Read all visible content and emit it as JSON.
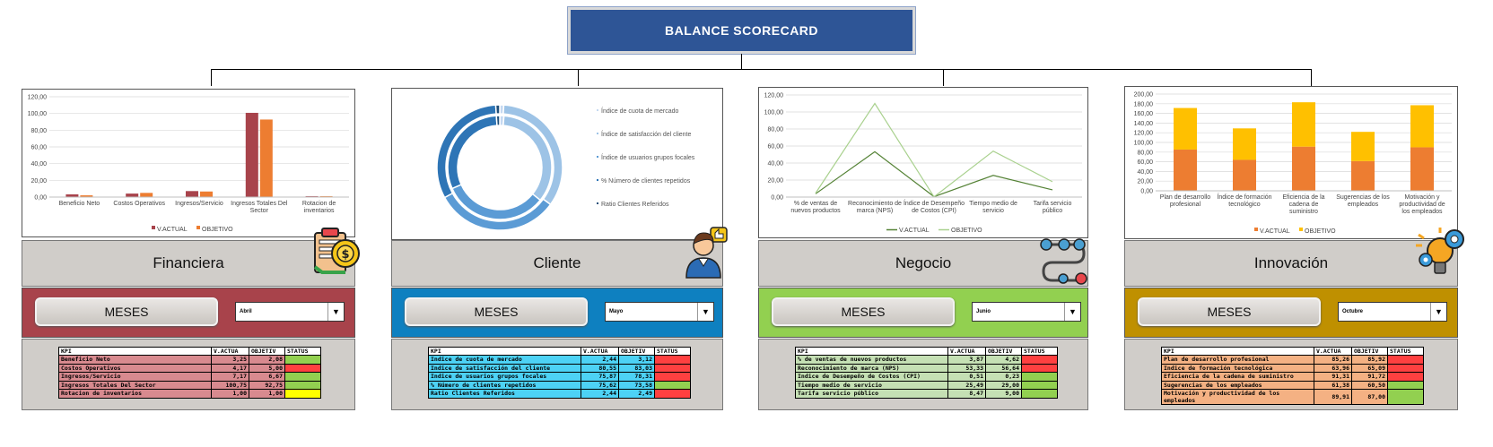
{
  "title": "BALANCE SCORECARD",
  "panels": [
    {
      "name": "Financiera",
      "meses_label": "MESES",
      "month": "Abril",
      "chart_color_band": "#a8434b",
      "table_row_color": "#d88a8f",
      "kpi_headers": [
        "KPI",
        "V.ACTUA",
        "OBJETIV",
        "STATUS"
      ],
      "rows": [
        {
          "kpi": "Beneficio Neto",
          "actual": "3,25",
          "objetivo": "2,08",
          "status": "#92d050"
        },
        {
          "kpi": "Costos Operativos",
          "actual": "4,17",
          "objetivo": "5,00",
          "status": "#ff4040"
        },
        {
          "kpi": "Ingresos/Servicio",
          "actual": "7,17",
          "objetivo": "6,67",
          "status": "#92d050"
        },
        {
          "kpi": "Ingresos Totales Del Sector",
          "actual": "100,75",
          "objetivo": "92,75",
          "status": "#92d050"
        },
        {
          "kpi": "Rotacion de inventarios",
          "actual": "1,00",
          "objetivo": "1,00",
          "status": "#ffff00"
        }
      ]
    },
    {
      "name": "Cliente",
      "meses_label": "MESES",
      "month": "Mayo",
      "chart_color_band": "#0e80c0",
      "table_row_color": "#4dd2f5",
      "kpi_headers": [
        "KPI",
        "V.ACTUA",
        "OBJETIV",
        "STATUS"
      ],
      "rows": [
        {
          "kpi": "Indice de cuota de mercado",
          "actual": "2,44",
          "objetivo": "3,12",
          "status": "#ff4040"
        },
        {
          "kpi": "Indice de satisfacción del cliente",
          "actual": "80,55",
          "objetivo": "83,03",
          "status": "#ff4040"
        },
        {
          "kpi": "Indice de usuarios grupos focales",
          "actual": "75,87",
          "objetivo": "78,31",
          "status": "#ff4040"
        },
        {
          "kpi": "% Número de clientes repetidos",
          "actual": "75,62",
          "objetivo": "73,58",
          "status": "#92d050"
        },
        {
          "kpi": "Ratio Clientes Referidos",
          "actual": "2,44",
          "objetivo": "2,49",
          "status": "#ff4040"
        }
      ]
    },
    {
      "name": "Negocio",
      "meses_label": "MESES",
      "month": "Junio",
      "chart_color_band": "#92d050",
      "table_row_color": "#c5e0b4",
      "kpi_headers": [
        "KPI",
        "V.ACTUA",
        "OBJETIV",
        "STATUS"
      ],
      "rows": [
        {
          "kpi": "% de ventas de nuevos productos",
          "actual": "3,87",
          "objetivo": "4,62",
          "status": "#ff4040"
        },
        {
          "kpi": "Reconocimiento de marca (NPS)",
          "actual": "53,33",
          "objetivo": "56,64",
          "status": "#ff4040"
        },
        {
          "kpi": "Indice de Desempeño de Costos (CPI)",
          "actual": "0,51",
          "objetivo": "0,23",
          "status": "#92d050"
        },
        {
          "kpi": "Tiempo medio de servicio",
          "actual": "25,49",
          "objetivo": "29,00",
          "status": "#92d050"
        },
        {
          "kpi": "Tarifa servicio público",
          "actual": "8,47",
          "objetivo": "9,00",
          "status": "#92d050"
        }
      ]
    },
    {
      "name": "Innovación",
      "meses_label": "MESES",
      "month": "Octubre",
      "chart_color_band": "#bf9000",
      "table_row_color": "#f4b183",
      "kpi_headers": [
        "KPI",
        "V.ACTUA",
        "OBJETIV",
        "STATUS"
      ],
      "rows": [
        {
          "kpi": "Plan de desarrollo profesional",
          "actual": "85,26",
          "objetivo": "85,92",
          "status": "#ff4040"
        },
        {
          "kpi": "Indice de formación tecnológica",
          "actual": "63,96",
          "objetivo": "65,09",
          "status": "#ff4040"
        },
        {
          "kpi": "Eficiencia de la cadena de suministro",
          "actual": "91,31",
          "objetivo": "91,72",
          "status": "#ff4040"
        },
        {
          "kpi": "Sugerencias de los empleados",
          "actual": "61,38",
          "objetivo": "60,50",
          "status": "#92d050"
        },
        {
          "kpi": "Motivación y productividad de los empleados",
          "actual": "89,91",
          "objetivo": "87,00",
          "status": "#92d050"
        }
      ]
    }
  ],
  "chart_data": [
    {
      "type": "bar",
      "categories": [
        "Beneficio Neto",
        "Costos Operativos",
        "Ingresos/Servicio",
        "Ingresos Totales Del Sector",
        "Rotacion de inventarios"
      ],
      "series": [
        {
          "name": "V.ACTUAL",
          "values": [
            3.25,
            4.17,
            7.17,
            100.75,
            1.0
          ],
          "color": "#a8434b"
        },
        {
          "name": "OBJETIVO",
          "values": [
            2.08,
            5.0,
            6.67,
            92.75,
            1.0
          ],
          "color": "#ed7d31"
        }
      ],
      "yticks": [
        "0,00",
        "20,00",
        "40,00",
        "60,00",
        "80,00",
        "100,00",
        "120,00"
      ],
      "ylim": [
        0,
        120
      ]
    },
    {
      "type": "pie",
      "categories": [
        "Índice de cuota de mercado",
        "Índice de satisfacción del cliente",
        "Índice de usuarios grupos focales",
        "% Número de clientes repetidos",
        "Ratio Clientes Referidos"
      ],
      "series": [
        {
          "name": "outer",
          "values": [
            2.44,
            80.55,
            75.87,
            75.62,
            2.44
          ]
        },
        {
          "name": "inner",
          "values": [
            3.12,
            83.03,
            78.31,
            73.58,
            2.49
          ]
        }
      ],
      "colors": [
        "#c5d9f1",
        "#9dc3e6",
        "#5b9bd5",
        "#2e75b6",
        "#1f4e79"
      ]
    },
    {
      "type": "line",
      "categories": [
        "% de ventas de nuevos productos",
        "Reconocimiento de marca (NPS)",
        "Índice de Desempeño de Costos (CPI)",
        "Tiempo medio de servicio",
        "Tarifa servicio público"
      ],
      "series": [
        {
          "name": "V.ACTUAL",
          "values": [
            3.87,
            53.33,
            0.51,
            25.49,
            8.47
          ],
          "color": "#548235"
        },
        {
          "name": "OBJETIVO",
          "values": [
            4.62,
            110.0,
            0.23,
            54.0,
            18.0
          ],
          "color": "#a9d18e"
        }
      ],
      "yticks": [
        "0,00",
        "20,00",
        "40,00",
        "60,00",
        "80,00",
        "100,00",
        "120,00"
      ],
      "ylim": [
        0,
        120
      ]
    },
    {
      "type": "bar",
      "stacked": true,
      "categories": [
        "Plan de desarrollo profesional",
        "Índice de formación tecnológico",
        "Eficiencia de la cadena de suministro",
        "Sugerencias de los empleados",
        "Motivación y productividad de los empleados"
      ],
      "series": [
        {
          "name": "V.ACTUAL",
          "values": [
            85.26,
            63.96,
            91.31,
            61.38,
            89.91
          ],
          "color": "#ed7d31"
        },
        {
          "name": "OBJETIVO",
          "values": [
            85.92,
            65.09,
            91.72,
            60.5,
            87.0
          ],
          "color": "#ffc000"
        }
      ],
      "yticks": [
        "0,00",
        "20,00",
        "40,00",
        "60,00",
        "80,00",
        "100,00",
        "120,00",
        "140,00",
        "160,00",
        "180,00",
        "200,00"
      ],
      "ylim": [
        0,
        200
      ]
    }
  ]
}
